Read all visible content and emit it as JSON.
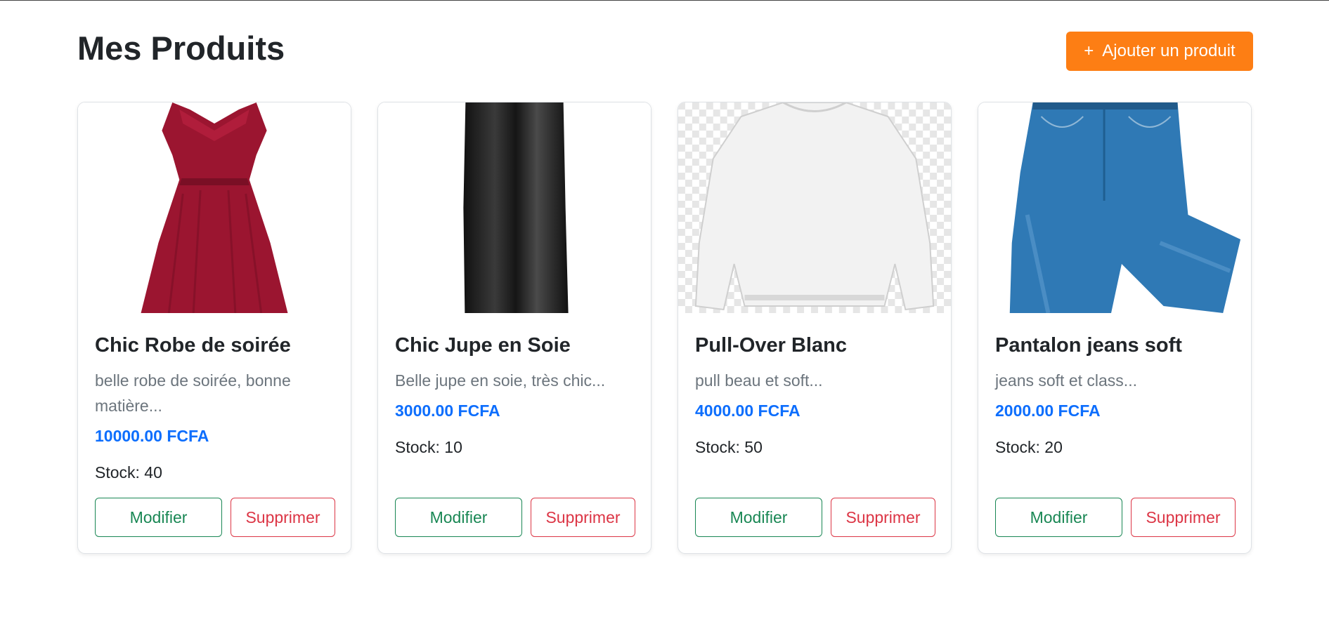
{
  "page": {
    "title": "Mes Produits",
    "add_button": {
      "icon": "+",
      "label": "Ajouter un produit"
    }
  },
  "colors": {
    "accent_orange": "#fd7e14",
    "price_blue": "#0d6efd",
    "edit_green": "#198754",
    "delete_red": "#dc3545"
  },
  "products": [
    {
      "image": "red-dress-image",
      "name": "Chic Robe de soirée",
      "description": "belle robe de soirée, bonne matière...",
      "price": "10000.00 FCFA",
      "stock": "Stock: 40",
      "edit_label": "Modifier",
      "delete_label": "Supprimer"
    },
    {
      "image": "black-silk-skirt-image",
      "name": "Chic Jupe en Soie",
      "description": "Belle jupe en soie, très chic...",
      "price": "3000.00 FCFA",
      "stock": "Stock: 10",
      "edit_label": "Modifier",
      "delete_label": "Supprimer"
    },
    {
      "image": "white-sweater-image",
      "name": "Pull-Over Blanc",
      "description": "pull beau et soft...",
      "price": "4000.00 FCFA",
      "stock": "Stock: 50",
      "edit_label": "Modifier",
      "delete_label": "Supprimer"
    },
    {
      "image": "blue-jeans-image",
      "name": "Pantalon jeans soft",
      "description": "jeans soft et class...",
      "price": "2000.00 FCFA",
      "stock": "Stock: 20",
      "edit_label": "Modifier",
      "delete_label": "Supprimer"
    }
  ]
}
